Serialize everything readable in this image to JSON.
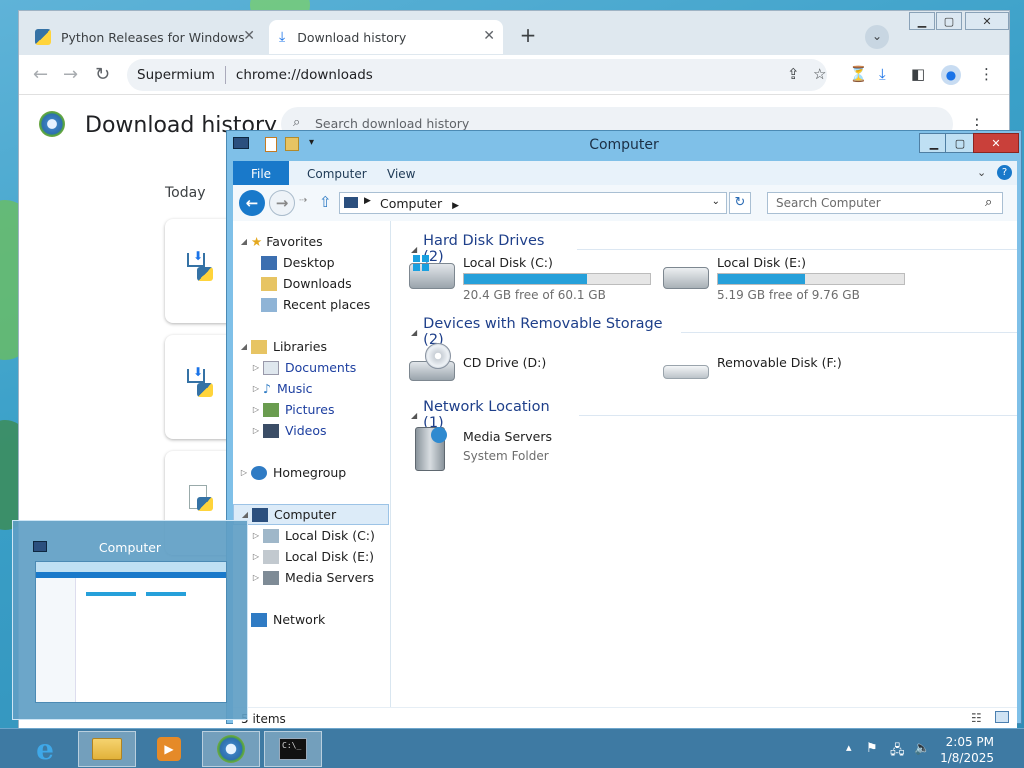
{
  "browser": {
    "tabs": [
      {
        "label": "Python Releases for Windows | P"
      },
      {
        "label": "Download history"
      }
    ],
    "new_tab": "+",
    "omnibox": {
      "site": "Supermium",
      "url": "chrome://downloads"
    },
    "page": {
      "title": "Download history",
      "search_placeholder": "Search download history",
      "date_heading": "Today"
    }
  },
  "explorer": {
    "title": "Computer",
    "ribbon_tabs": [
      "File",
      "Computer",
      "View"
    ],
    "address": "Computer",
    "search_placeholder": "Search Computer",
    "nav": {
      "favorites": "Favorites",
      "desktop": "Desktop",
      "downloads": "Downloads",
      "recent": "Recent places",
      "libraries": "Libraries",
      "documents": "Documents",
      "music": "Music",
      "pictures": "Pictures",
      "videos": "Videos",
      "homegroup": "Homegroup",
      "computer": "Computer",
      "local_c": "Local Disk (C:)",
      "local_e": "Local Disk (E:)",
      "media_servers": "Media Servers",
      "network": "Network"
    },
    "groups": {
      "hdd": "Hard Disk Drives (2)",
      "removable": "Devices with Removable Storage (2)",
      "network": "Network Location (1)"
    },
    "drives": [
      {
        "name": "Local Disk (C:)",
        "free": "20.4 GB free of 60.1 GB",
        "used_fraction": 0.66
      },
      {
        "name": "Local Disk (E:)",
        "free": "5.19 GB free of 9.76 GB",
        "used_fraction": 0.47
      }
    ],
    "removable": [
      {
        "name": "CD Drive (D:)"
      },
      {
        "name": "Removable Disk (F:)"
      }
    ],
    "network_item": {
      "name": "Media Servers",
      "sub": "System Folder"
    },
    "status": "5 items"
  },
  "thumbnail": {
    "title": "Computer"
  },
  "taskbar": {
    "time": "2:05 PM",
    "date": "1/8/2025"
  },
  "colors": {
    "accent": "#1979ca",
    "drive_bar": "#26a0da",
    "taskbar": "#3e7aa3"
  }
}
